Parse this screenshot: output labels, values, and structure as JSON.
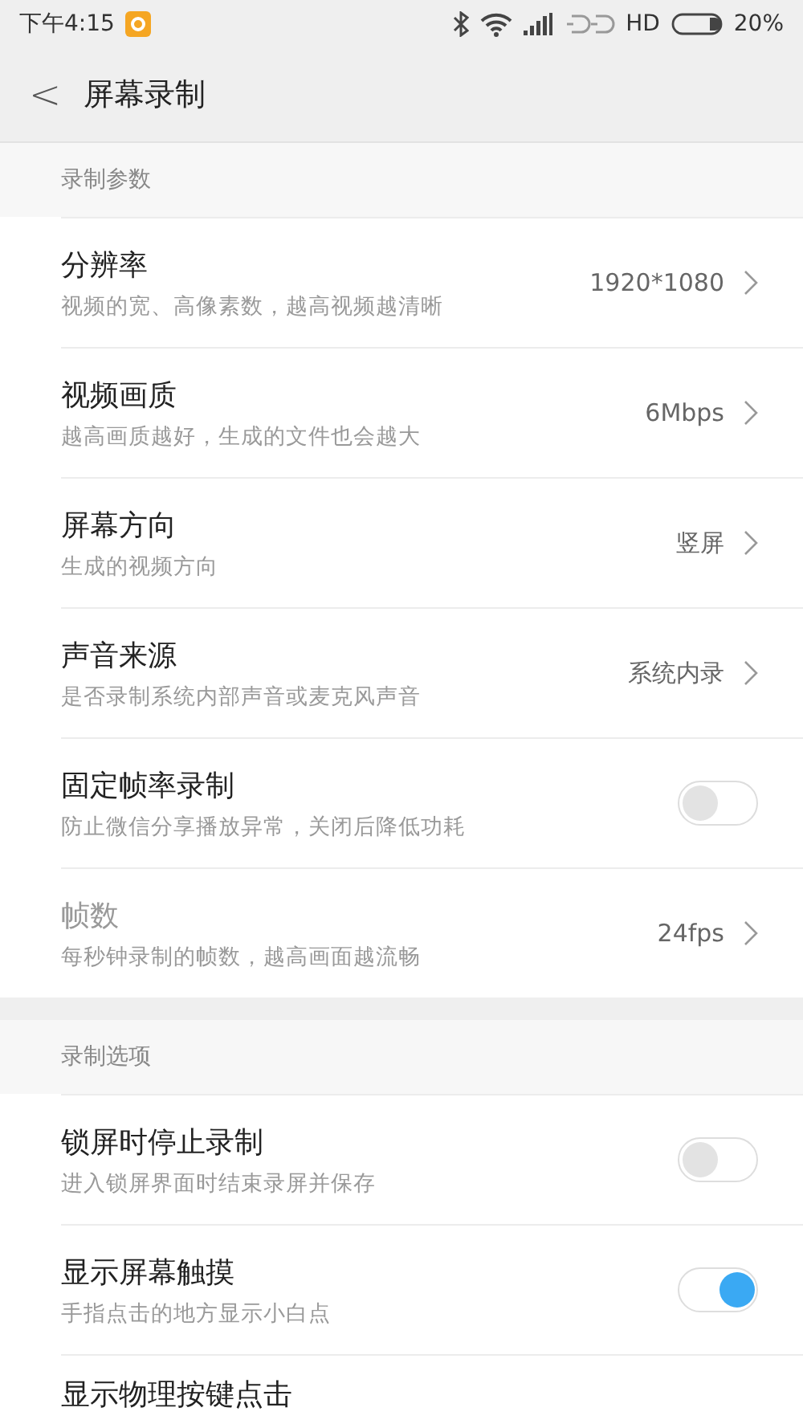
{
  "status_bar": {
    "time": "下午4:15",
    "network": "HD",
    "battery": "20%"
  },
  "header": {
    "back": "<",
    "title": "屏幕录制"
  },
  "sections": [
    {
      "title": "录制参数",
      "items": [
        {
          "kind": "nav",
          "title": "分辨率",
          "subtitle": "视频的宽、高像素数，越高视频越清晰",
          "value": "1920*1080",
          "disabled": false
        },
        {
          "kind": "nav",
          "title": "视频画质",
          "subtitle": "越高画质越好，生成的文件也会越大",
          "value": "6Mbps",
          "disabled": false
        },
        {
          "kind": "nav",
          "title": "屏幕方向",
          "subtitle": "生成的视频方向",
          "value": "竖屏",
          "disabled": false
        },
        {
          "kind": "nav",
          "title": "声音来源",
          "subtitle": "是否录制系统内部声音或麦克风声音",
          "value": "系统内录",
          "disabled": false
        },
        {
          "kind": "toggle",
          "title": "固定帧率录制",
          "subtitle": "防止微信分享播放异常，关闭后降低功耗",
          "on": false,
          "disabled": false
        },
        {
          "kind": "nav",
          "title": "帧数",
          "subtitle": "每秒钟录制的帧数，越高画面越流畅",
          "value": "24fps",
          "disabled": true
        }
      ]
    },
    {
      "title": "录制选项",
      "items": [
        {
          "kind": "toggle",
          "title": "锁屏时停止录制",
          "subtitle": "进入锁屏界面时结束录屏并保存",
          "on": false,
          "disabled": false
        },
        {
          "kind": "toggle",
          "title": "显示屏幕触摸",
          "subtitle": "手指点击的地方显示小白点",
          "on": true,
          "disabled": false
        },
        {
          "kind": "partial",
          "title": "显示物理按键点击"
        }
      ]
    }
  ]
}
